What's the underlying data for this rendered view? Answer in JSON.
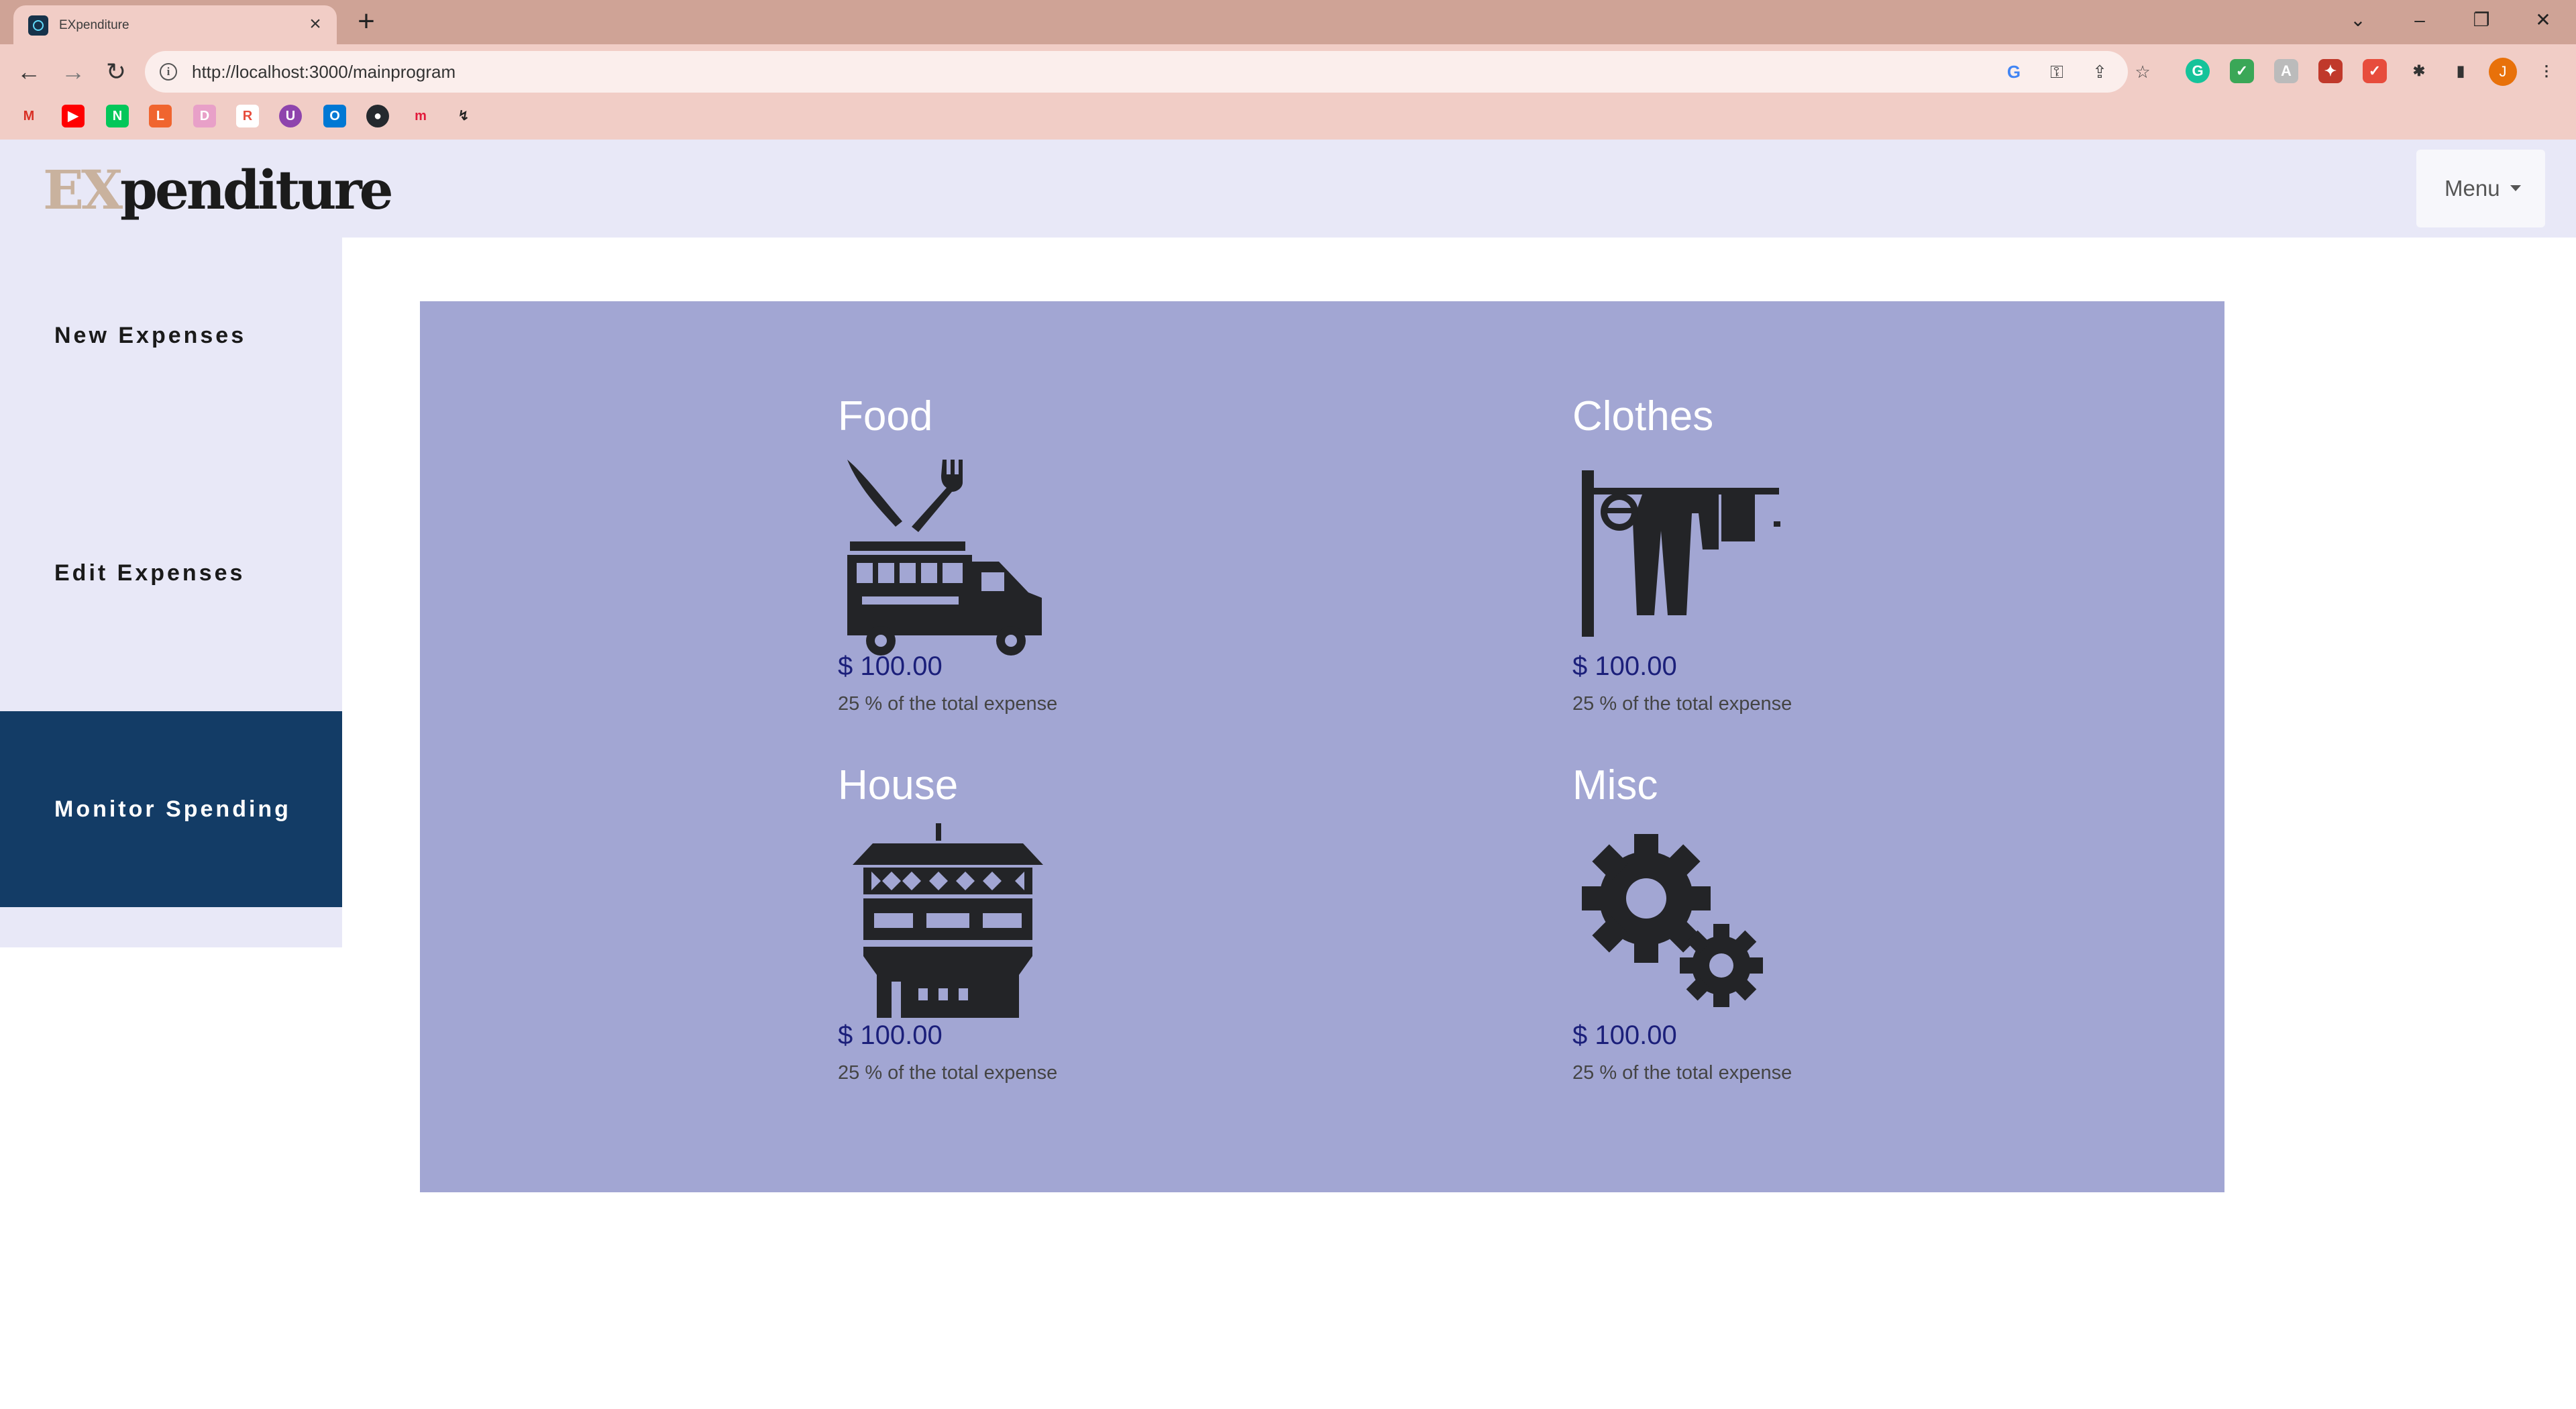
{
  "browser": {
    "tab_title": "EXpenditure",
    "tab_close": "×",
    "new_tab": "+",
    "url": "http://localhost:3000/mainprogram",
    "profile_initial": "J",
    "window_controls": [
      "⌄",
      "–",
      "❐",
      "✕"
    ]
  },
  "app": {
    "brand_prefix": "EX",
    "brand_suffix": "penditure",
    "menu_label": "Menu",
    "accent_color": "#133c66",
    "panel_color": "#a2a6d3"
  },
  "sidebar": {
    "items": [
      {
        "label": "New Expenses",
        "active": false
      },
      {
        "label": "Edit Expenses",
        "active": false
      },
      {
        "label": "Monitor Spending",
        "active": true
      }
    ]
  },
  "categories": [
    {
      "title": "Food",
      "icon": "food-truck-icon",
      "amount": "$ 100.00",
      "percent_text": "25 % of the total expense"
    },
    {
      "title": "Clothes",
      "icon": "clothesline-icon",
      "amount": "$ 100.00",
      "percent_text": "25 % of the total expense"
    },
    {
      "title": "House",
      "icon": "house-icon",
      "amount": "$ 100.00",
      "percent_text": "25 % of the total expense"
    },
    {
      "title": "Misc",
      "icon": "gears-icon",
      "amount": "$ 100.00",
      "percent_text": "25 % of the total expense"
    }
  ]
}
